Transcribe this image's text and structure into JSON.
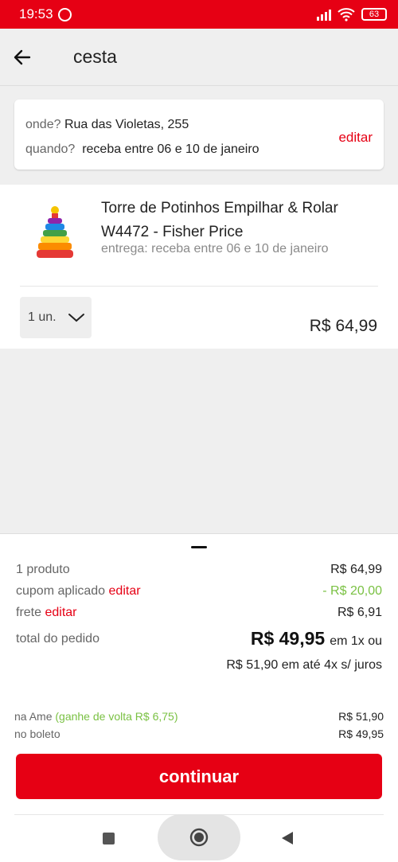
{
  "status_bar": {
    "time": "19:53",
    "battery": "63"
  },
  "header": {
    "title": "cesta"
  },
  "delivery": {
    "where_label": "onde?",
    "where_value": "Rua das Violetas, 255",
    "when_label": "quando?",
    "when_value": "receba entre 06 e 10 de janeiro",
    "edit_label": "editar"
  },
  "product": {
    "name": "Torre de Potinhos Empilhar & Rolar W4472 - Fisher Price",
    "shipping": "entrega: receba entre 06 e 10 de janeiro",
    "quantity": "1 un.",
    "price": "R$ 64,99"
  },
  "summary": {
    "products_label": "1 produto",
    "products_value": "R$ 64,99",
    "coupon_label": "cupom aplicado",
    "coupon_edit": "editar",
    "coupon_value": "- R$ 20,00",
    "shipping_label": "frete",
    "shipping_edit": "editar",
    "shipping_value": "R$ 6,91",
    "total_label": "total do pedido",
    "total_value": "R$ 49,95",
    "total_suffix": "em 1x ou",
    "installments": "R$ 51,90 em até 4x s/ juros",
    "ame_label": "na Ame",
    "ame_cashback": "(ganhe de volta R$ 6,75)",
    "ame_value": "R$ 51,90",
    "boleto_label": "no boleto",
    "boleto_value": "R$ 49,95",
    "continue_label": "continuar"
  },
  "colors": {
    "brand": "#e60014",
    "discount": "#7ac143"
  }
}
